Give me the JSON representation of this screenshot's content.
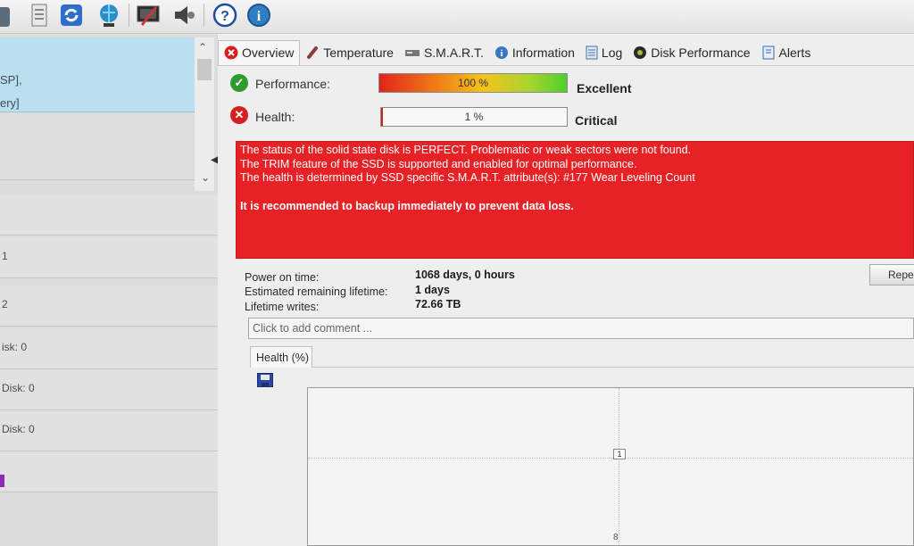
{
  "left_panel": {
    "top_lines": [
      "SP],",
      "ery]"
    ],
    "rows": [
      "1",
      "2",
      "isk: 0",
      "Disk: 0",
      "Disk: 0",
      ""
    ]
  },
  "tabs": [
    {
      "label": "Overview",
      "icon": "red-x-icon"
    },
    {
      "label": "Temperature",
      "icon": "thermometer-icon"
    },
    {
      "label": "S.M.A.R.T.",
      "icon": "drive-icon"
    },
    {
      "label": "Information",
      "icon": "info-icon"
    },
    {
      "label": "Log",
      "icon": "log-icon"
    },
    {
      "label": "Disk Performance",
      "icon": "disk-performance-icon"
    },
    {
      "label": "Alerts",
      "icon": "alerts-icon"
    }
  ],
  "performance": {
    "label": "Performance:",
    "value_text": "100 %",
    "value": 100,
    "result": "Excellent",
    "icon": "green-check-icon"
  },
  "health": {
    "label": "Health:",
    "value_text": "1 %",
    "value": 1,
    "result": "Critical",
    "icon": "red-x-icon"
  },
  "message": {
    "line1": "The status of the solid state disk is PERFECT. Problematic or weak sectors were not found.",
    "line2": "The TRIM feature of the SSD is supported and enabled for optimal performance.",
    "line3": "The health is determined by SSD specific S.M.A.R.T. attribute(s):  #177 Wear Leveling Count",
    "recommendation": "It is recommended to backup immediately to prevent data loss.",
    "color": "#e62226"
  },
  "stats": [
    {
      "label": "Power on time:",
      "value": "1068 days, 0 hours"
    },
    {
      "label": "Estimated remaining lifetime:",
      "value": "1 days"
    },
    {
      "label": "Lifetime writes:",
      "value": "72.66 TB"
    }
  ],
  "repeat_button": "Repea",
  "comment_placeholder": "Click to add comment ...",
  "chart_tab": "Health (%)",
  "chart_point_label": "1",
  "chart_bottom_label": "8"
}
